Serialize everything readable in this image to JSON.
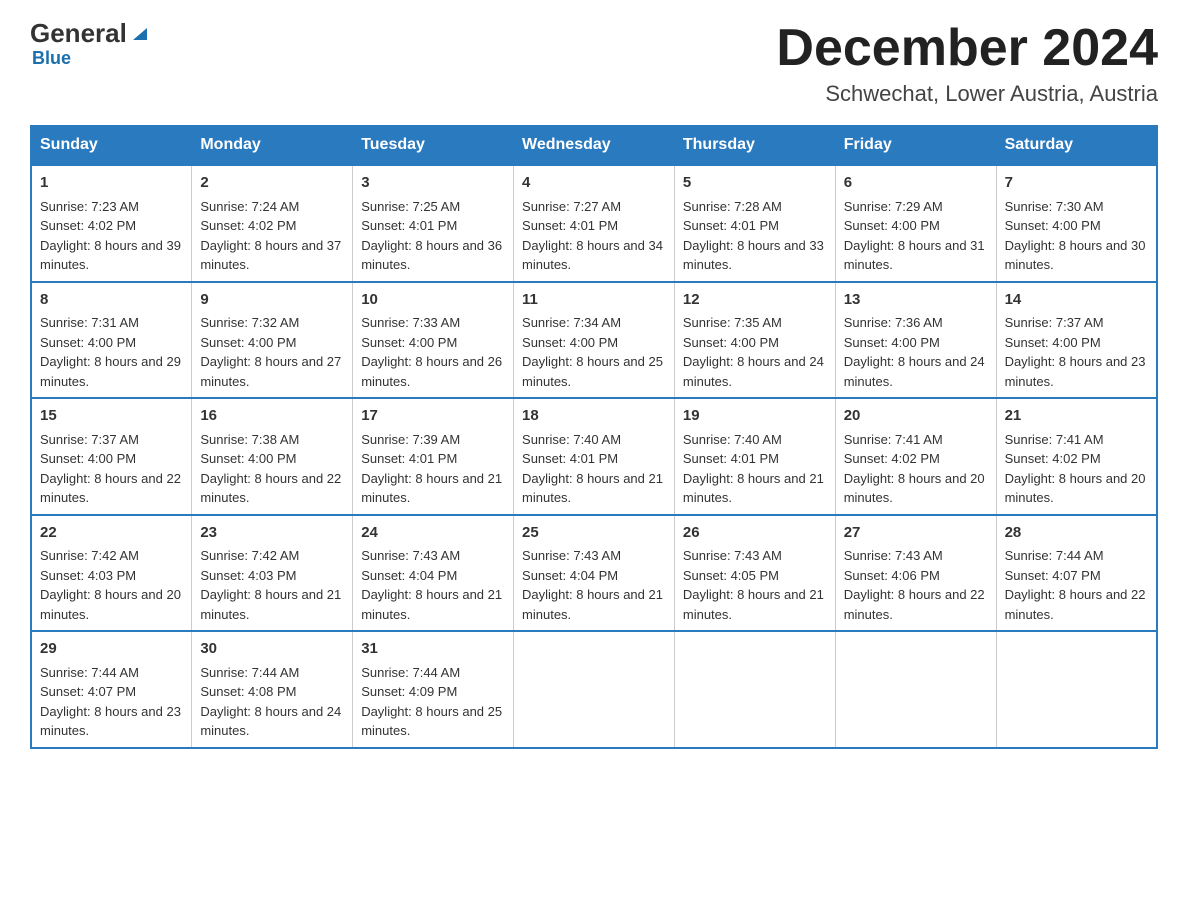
{
  "logo": {
    "text_general": "General",
    "text_blue": "Blue"
  },
  "header": {
    "month_year": "December 2024",
    "location": "Schwechat, Lower Austria, Austria"
  },
  "columns": [
    "Sunday",
    "Monday",
    "Tuesday",
    "Wednesday",
    "Thursday",
    "Friday",
    "Saturday"
  ],
  "weeks": [
    [
      {
        "day": "1",
        "sunrise": "7:23 AM",
        "sunset": "4:02 PM",
        "daylight": "8 hours and 39 minutes."
      },
      {
        "day": "2",
        "sunrise": "7:24 AM",
        "sunset": "4:02 PM",
        "daylight": "8 hours and 37 minutes."
      },
      {
        "day": "3",
        "sunrise": "7:25 AM",
        "sunset": "4:01 PM",
        "daylight": "8 hours and 36 minutes."
      },
      {
        "day": "4",
        "sunrise": "7:27 AM",
        "sunset": "4:01 PM",
        "daylight": "8 hours and 34 minutes."
      },
      {
        "day": "5",
        "sunrise": "7:28 AM",
        "sunset": "4:01 PM",
        "daylight": "8 hours and 33 minutes."
      },
      {
        "day": "6",
        "sunrise": "7:29 AM",
        "sunset": "4:00 PM",
        "daylight": "8 hours and 31 minutes."
      },
      {
        "day": "7",
        "sunrise": "7:30 AM",
        "sunset": "4:00 PM",
        "daylight": "8 hours and 30 minutes."
      }
    ],
    [
      {
        "day": "8",
        "sunrise": "7:31 AM",
        "sunset": "4:00 PM",
        "daylight": "8 hours and 29 minutes."
      },
      {
        "day": "9",
        "sunrise": "7:32 AM",
        "sunset": "4:00 PM",
        "daylight": "8 hours and 27 minutes."
      },
      {
        "day": "10",
        "sunrise": "7:33 AM",
        "sunset": "4:00 PM",
        "daylight": "8 hours and 26 minutes."
      },
      {
        "day": "11",
        "sunrise": "7:34 AM",
        "sunset": "4:00 PM",
        "daylight": "8 hours and 25 minutes."
      },
      {
        "day": "12",
        "sunrise": "7:35 AM",
        "sunset": "4:00 PM",
        "daylight": "8 hours and 24 minutes."
      },
      {
        "day": "13",
        "sunrise": "7:36 AM",
        "sunset": "4:00 PM",
        "daylight": "8 hours and 24 minutes."
      },
      {
        "day": "14",
        "sunrise": "7:37 AM",
        "sunset": "4:00 PM",
        "daylight": "8 hours and 23 minutes."
      }
    ],
    [
      {
        "day": "15",
        "sunrise": "7:37 AM",
        "sunset": "4:00 PM",
        "daylight": "8 hours and 22 minutes."
      },
      {
        "day": "16",
        "sunrise": "7:38 AM",
        "sunset": "4:00 PM",
        "daylight": "8 hours and 22 minutes."
      },
      {
        "day": "17",
        "sunrise": "7:39 AM",
        "sunset": "4:01 PM",
        "daylight": "8 hours and 21 minutes."
      },
      {
        "day": "18",
        "sunrise": "7:40 AM",
        "sunset": "4:01 PM",
        "daylight": "8 hours and 21 minutes."
      },
      {
        "day": "19",
        "sunrise": "7:40 AM",
        "sunset": "4:01 PM",
        "daylight": "8 hours and 21 minutes."
      },
      {
        "day": "20",
        "sunrise": "7:41 AM",
        "sunset": "4:02 PM",
        "daylight": "8 hours and 20 minutes."
      },
      {
        "day": "21",
        "sunrise": "7:41 AM",
        "sunset": "4:02 PM",
        "daylight": "8 hours and 20 minutes."
      }
    ],
    [
      {
        "day": "22",
        "sunrise": "7:42 AM",
        "sunset": "4:03 PM",
        "daylight": "8 hours and 20 minutes."
      },
      {
        "day": "23",
        "sunrise": "7:42 AM",
        "sunset": "4:03 PM",
        "daylight": "8 hours and 21 minutes."
      },
      {
        "day": "24",
        "sunrise": "7:43 AM",
        "sunset": "4:04 PM",
        "daylight": "8 hours and 21 minutes."
      },
      {
        "day": "25",
        "sunrise": "7:43 AM",
        "sunset": "4:04 PM",
        "daylight": "8 hours and 21 minutes."
      },
      {
        "day": "26",
        "sunrise": "7:43 AM",
        "sunset": "4:05 PM",
        "daylight": "8 hours and 21 minutes."
      },
      {
        "day": "27",
        "sunrise": "7:43 AM",
        "sunset": "4:06 PM",
        "daylight": "8 hours and 22 minutes."
      },
      {
        "day": "28",
        "sunrise": "7:44 AM",
        "sunset": "4:07 PM",
        "daylight": "8 hours and 22 minutes."
      }
    ],
    [
      {
        "day": "29",
        "sunrise": "7:44 AM",
        "sunset": "4:07 PM",
        "daylight": "8 hours and 23 minutes."
      },
      {
        "day": "30",
        "sunrise": "7:44 AM",
        "sunset": "4:08 PM",
        "daylight": "8 hours and 24 minutes."
      },
      {
        "day": "31",
        "sunrise": "7:44 AM",
        "sunset": "4:09 PM",
        "daylight": "8 hours and 25 minutes."
      },
      null,
      null,
      null,
      null
    ]
  ]
}
